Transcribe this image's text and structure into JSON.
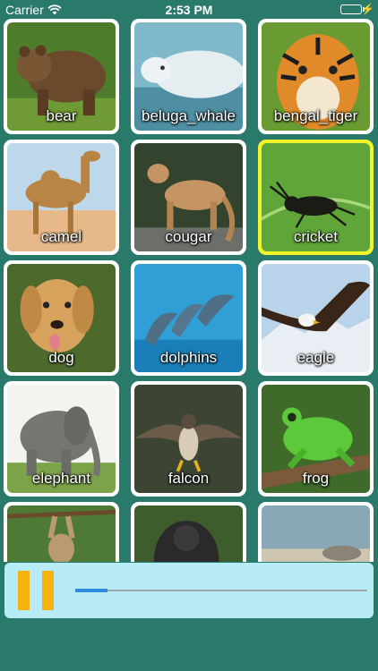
{
  "status_bar": {
    "carrier": "Carrier",
    "time": "2:53 PM"
  },
  "animals": [
    {
      "label": "bear",
      "selected": false
    },
    {
      "label": "beluga_whale",
      "selected": false
    },
    {
      "label": "bengal_tiger",
      "selected": false
    },
    {
      "label": "camel",
      "selected": false
    },
    {
      "label": "cougar",
      "selected": false
    },
    {
      "label": "cricket",
      "selected": true
    },
    {
      "label": "dog",
      "selected": false
    },
    {
      "label": "dolphins",
      "selected": false
    },
    {
      "label": "eagle",
      "selected": false
    },
    {
      "label": "elephant",
      "selected": false
    },
    {
      "label": "falcon",
      "selected": false
    },
    {
      "label": "frog",
      "selected": false
    },
    {
      "label": "",
      "selected": false
    },
    {
      "label": "",
      "selected": false
    },
    {
      "label": "",
      "selected": false
    }
  ],
  "player": {
    "state": "playing",
    "progress": 0.11
  },
  "colors": {
    "background": "#2a7a6b",
    "selected_border": "#f3f32a",
    "player_bg": "#b7ecf7",
    "pause_icon": "#f6b10d",
    "progress_fill": "#2f8be0"
  }
}
